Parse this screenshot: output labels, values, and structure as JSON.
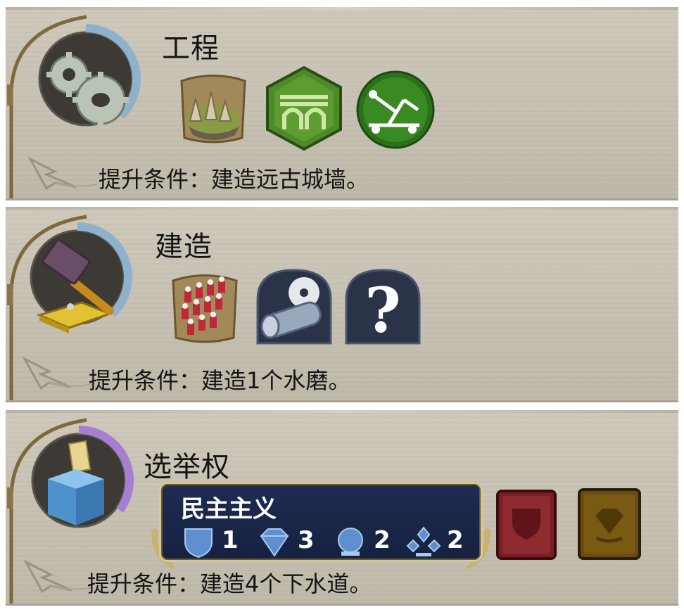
{
  "panels": [
    {
      "title": "工程",
      "badge_icon": "gears-icon",
      "progress_fraction": 0.38,
      "progress_color": "#8fb2cc",
      "unlocks": [
        {
          "icon": "ancient-city-icon",
          "style": "gold-frame"
        },
        {
          "icon": "aqueduct-icon",
          "style": "green-hexagon"
        },
        {
          "icon": "catapult-icon",
          "style": "green-circle"
        }
      ],
      "condition": "提升条件：建造远古城墙。"
    },
    {
      "title": "建造",
      "badge_icon": "hammer-icon",
      "progress_fraction": 0.38,
      "progress_color": "#8fb2cc",
      "unlocks": [
        {
          "icon": "soldiers-icon",
          "style": "gold-frame"
        },
        {
          "icon": "sawmill-icon",
          "style": "dark-arch"
        },
        {
          "icon": "question-mark-icon",
          "style": "dark-arch"
        }
      ],
      "condition": "提升条件：建造1个水磨。"
    },
    {
      "title": "选举权",
      "badge_icon": "ballot-box-icon",
      "progress_fraction": 0.35,
      "progress_color": "#a77fd0",
      "government": {
        "name": "民主主义",
        "stats": [
          {
            "icon": "shield-icon",
            "value": "1"
          },
          {
            "icon": "gem-icon",
            "value": "3"
          },
          {
            "icon": "orb-icon",
            "value": "2"
          },
          {
            "icon": "trade-icon",
            "value": "2"
          }
        ]
      },
      "extra_unlocks": [
        {
          "icon": "red-policy-card-icon",
          "color": "#7a1e24"
        },
        {
          "icon": "gold-policy-card-icon",
          "color": "#7a5a12"
        }
      ],
      "condition": "提升条件：建造4个下水道。"
    }
  ]
}
